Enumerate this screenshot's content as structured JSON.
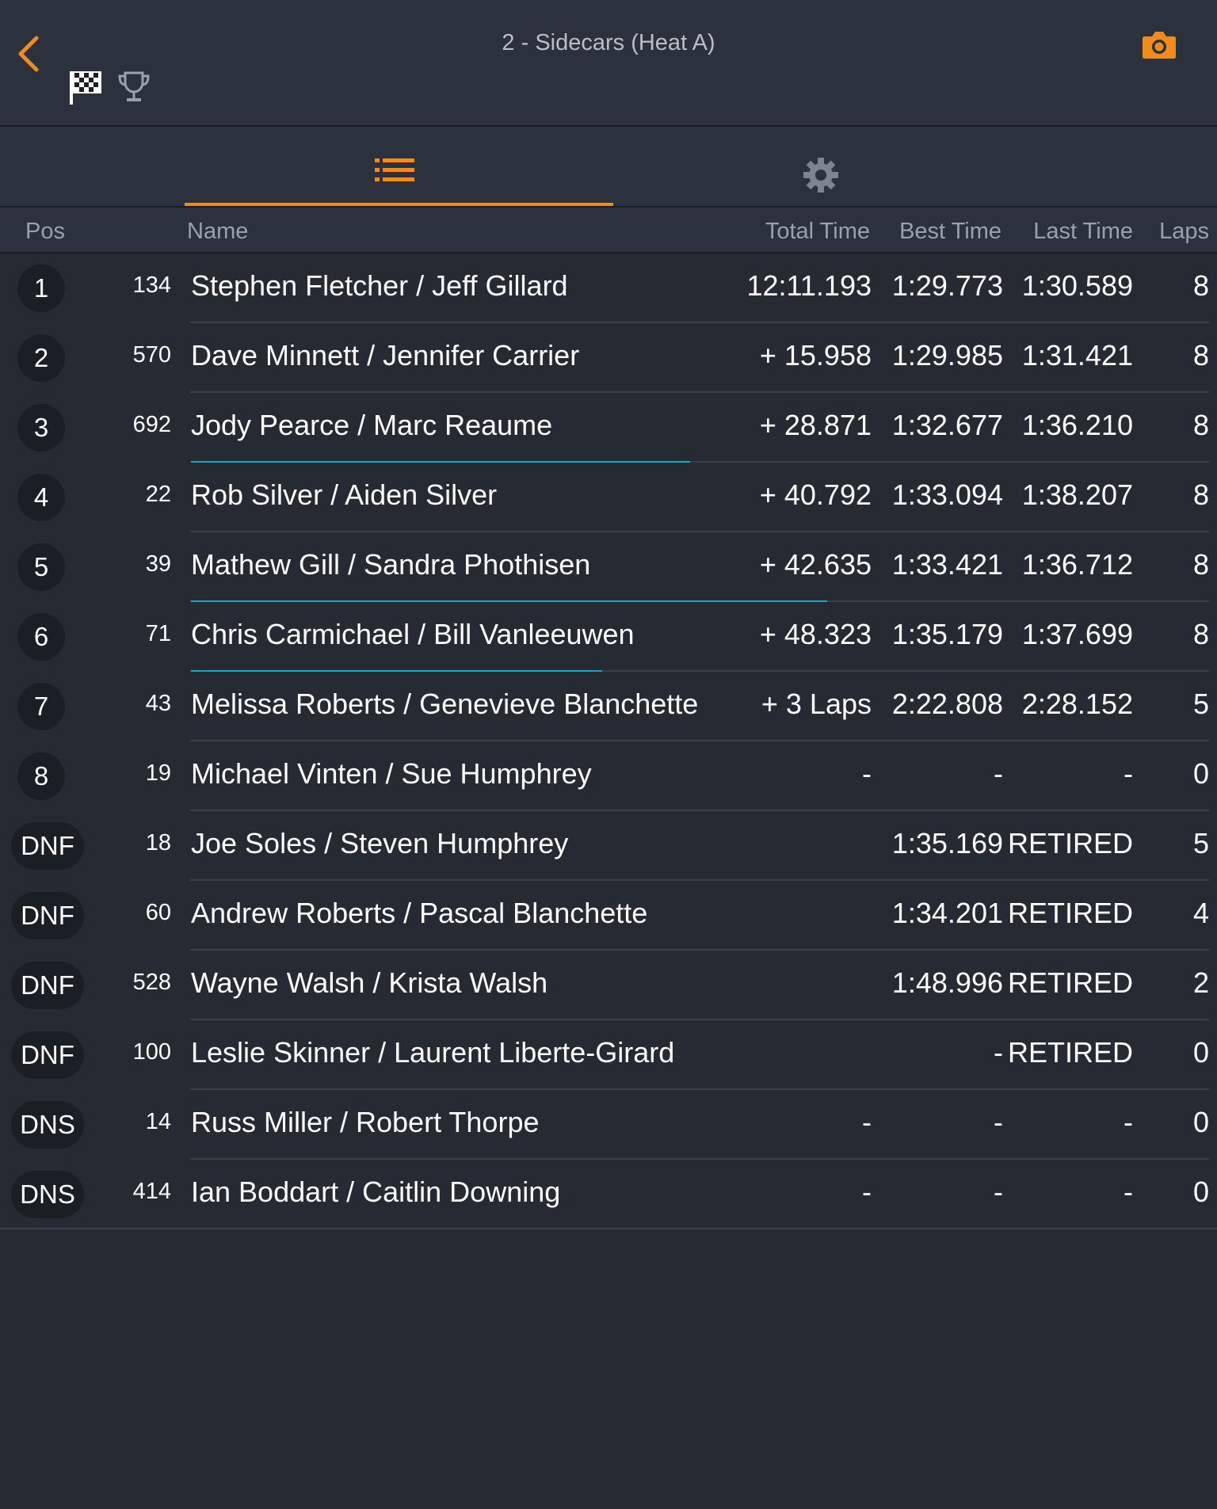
{
  "header": {
    "title": "2 - Sidecars (Heat A)"
  },
  "colors": {
    "accent": "#f08c1e",
    "background": "#252a33",
    "progress": "#1aa7c2"
  },
  "columns": {
    "pos": "Pos",
    "name": "Name",
    "total": "Total Time",
    "best": "Best Time",
    "last": "Last Time",
    "laps": "Laps"
  },
  "rows": [
    {
      "pos": "1",
      "num": "134",
      "name": "Stephen Fletcher /  Jeff Gillard",
      "total": "12:11.193",
      "best": "1:29.773",
      "last": "1:30.589",
      "laps": "8"
    },
    {
      "pos": "2",
      "num": "570",
      "name": "Dave Minnett /  Jennifer Carrier",
      "total": "+ 15.958",
      "best": "1:29.985",
      "last": "1:31.421",
      "laps": "8"
    },
    {
      "pos": "3",
      "num": "692",
      "name": "Jody Pearce /  Marc Reaume",
      "total": "+ 28.871",
      "best": "1:32.677",
      "last": "1:36.210",
      "laps": "8",
      "progress": 0.51
    },
    {
      "pos": "4",
      "num": "22",
      "name": "Rob Silver /  Aiden Silver",
      "total": "+ 40.792",
      "best": "1:33.094",
      "last": "1:38.207",
      "laps": "8"
    },
    {
      "pos": "5",
      "num": "39",
      "name": "Mathew Gill /  Sandra Phothisen",
      "total": "+ 42.635",
      "best": "1:33.421",
      "last": "1:36.712",
      "laps": "8",
      "progress": 0.65
    },
    {
      "pos": "6",
      "num": "71",
      "name": "Chris Carmichael /  Bill Vanleeuwen",
      "total": "+ 48.323",
      "best": "1:35.179",
      "last": "1:37.699",
      "laps": "8",
      "progress": 0.42
    },
    {
      "pos": "7",
      "num": "43",
      "name": "Melissa Roberts /  Genevieve Blanchette",
      "total": "+ 3 Laps",
      "best": "2:22.808",
      "last": "2:28.152",
      "laps": "5"
    },
    {
      "pos": "8",
      "num": "19",
      "name": "Michael Vinten /  Sue Humphrey",
      "total": "-",
      "best": "-",
      "last": "-",
      "laps": "0"
    },
    {
      "pos": "DNF",
      "num": "18",
      "name": "Joe Soles /  Steven Humphrey",
      "total": "",
      "best": "1:35.169",
      "last": "RETIRED",
      "laps": "5"
    },
    {
      "pos": "DNF",
      "num": "60",
      "name": "Andrew Roberts /  Pascal Blanchette",
      "total": "",
      "best": "1:34.201",
      "last": "RETIRED",
      "laps": "4"
    },
    {
      "pos": "DNF",
      "num": "528",
      "name": "Wayne Walsh /  Krista Walsh",
      "total": "",
      "best": "1:48.996",
      "last": "RETIRED",
      "laps": "2"
    },
    {
      "pos": "DNF",
      "num": "100",
      "name": "Leslie Skinner /  Laurent Liberte-Girard",
      "total": "",
      "best": "-",
      "last": "RETIRED",
      "laps": "0"
    },
    {
      "pos": "DNS",
      "num": "14",
      "name": "Russ Miller /  Robert Thorpe",
      "total": "-",
      "best": "-",
      "last": "-",
      "laps": "0"
    },
    {
      "pos": "DNS",
      "num": "414",
      "name": "Ian Boddart /  Caitlin Downing",
      "total": "-",
      "best": "-",
      "last": "-",
      "laps": "0"
    }
  ]
}
